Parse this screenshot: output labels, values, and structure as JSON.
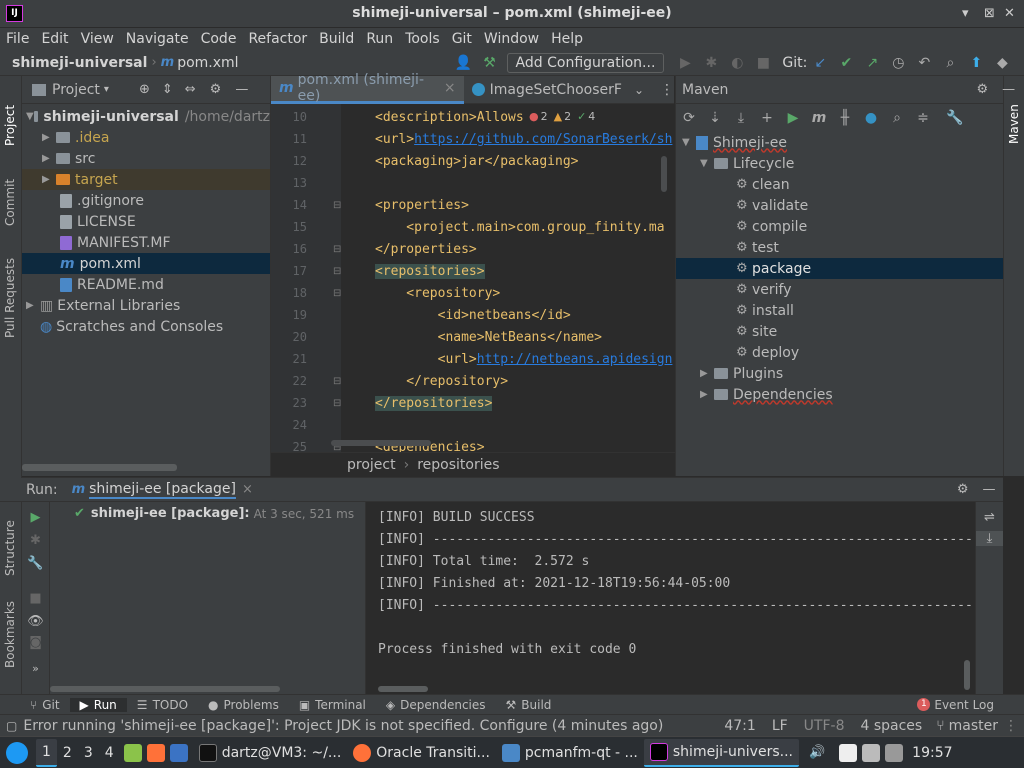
{
  "window": {
    "title": "shimeji-universal – pom.xml (shimeji-ee)",
    "app_icon": "IJ"
  },
  "menu": [
    "File",
    "Edit",
    "View",
    "Navigate",
    "Code",
    "Refactor",
    "Build",
    "Run",
    "Tools",
    "Git",
    "Window",
    "Help"
  ],
  "navbar": {
    "project": "shimeji-universal",
    "file": "pom.xml",
    "add_config": "Add Configuration...",
    "git_label": "Git:"
  },
  "left_stripe": [
    "Project",
    "Commit",
    "Pull Requests",
    "Structure",
    "Bookmarks"
  ],
  "right_stripe": [
    "Maven"
  ],
  "project_panel": {
    "title": "Project",
    "root": {
      "name": "shimeji-universal",
      "path": "/home/dartz"
    },
    "items": [
      {
        "label": ".idea",
        "kind": "folder"
      },
      {
        "label": "src",
        "kind": "folder"
      },
      {
        "label": "target",
        "kind": "folder"
      },
      {
        "label": ".gitignore",
        "kind": "file"
      },
      {
        "label": "LICENSE",
        "kind": "file"
      },
      {
        "label": "MANIFEST.MF",
        "kind": "file"
      },
      {
        "label": "pom.xml",
        "kind": "file"
      },
      {
        "label": "README.md",
        "kind": "file"
      }
    ],
    "external": "External Libraries",
    "scratches": "Scratches and Consoles"
  },
  "editor": {
    "tabs": [
      {
        "label": "pom.xml (shimeji-ee)"
      },
      {
        "label": "ImageSetChooserF"
      }
    ],
    "inspections": {
      "errors": "2",
      "warnings": "2",
      "ok": "4"
    },
    "lines": [
      {
        "n": "10",
        "text": "<description>Allows"
      },
      {
        "n": "11",
        "pre": "<url>",
        "link": "https://github.com/SonarBeserk/sh"
      },
      {
        "n": "12",
        "text": "<packaging>jar</packaging>"
      },
      {
        "n": "13",
        "text": ""
      },
      {
        "n": "14",
        "text": "<properties>"
      },
      {
        "n": "15",
        "text": "    <project.main>com.group_finity.ma"
      },
      {
        "n": "16",
        "text": "</properties>"
      },
      {
        "n": "17",
        "text": "<repositories>"
      },
      {
        "n": "18",
        "text": "    <repository>"
      },
      {
        "n": "19",
        "text": "        <id>netbeans</id>"
      },
      {
        "n": "20",
        "text": "        <name>NetBeans</name>"
      },
      {
        "n": "21",
        "pre": "        <url>",
        "link": "http://netbeans.apidesign"
      },
      {
        "n": "22",
        "text": "    </repository>"
      },
      {
        "n": "23",
        "text": "</repositories>"
      },
      {
        "n": "24",
        "text": ""
      },
      {
        "n": "25",
        "text": "<dependencies>"
      }
    ],
    "breadcrumb": [
      "project",
      "repositories"
    ]
  },
  "maven": {
    "title": "Maven",
    "project": "Shimeji-ee",
    "lifecycle": "Lifecycle",
    "goals": [
      "clean",
      "validate",
      "compile",
      "test",
      "package",
      "verify",
      "install",
      "site",
      "deploy"
    ],
    "plugins": "Plugins",
    "dependencies": "Dependencies"
  },
  "run": {
    "label": "Run:",
    "tab": "shimeji-ee [package]",
    "item": "shimeji-ee [package]:",
    "item_time": "At 3 sec, 521 ms",
    "output": [
      "[INFO] BUILD SUCCESS",
      "[INFO] ------------------------------------------------------------------------",
      "[INFO] Total time:  2.572 s",
      "[INFO] Finished at: 2021-12-18T19:56:44-05:00",
      "[INFO] ------------------------------------------------------------------------",
      "",
      "Process finished with exit code 0"
    ]
  },
  "tool_tabs": [
    "Git",
    "Run",
    "TODO",
    "Problems",
    "Terminal",
    "Dependencies",
    "Build"
  ],
  "event_log": {
    "count": "1",
    "label": "Event Log"
  },
  "status": {
    "message": "Error running 'shimeji-ee [package]': Project JDK is not specified. Configure (4 minutes ago)",
    "position": "47:1",
    "line_sep": "LF",
    "encoding": "UTF-8",
    "indent": "4 spaces",
    "branch": "master"
  },
  "taskbar": {
    "desktops": [
      "1",
      "2",
      "3",
      "4"
    ],
    "tasks": [
      "dartz@VM3: ~/...",
      "Oracle Transiti...",
      "pcmanfm-qt - ...",
      "shimeji-univers..."
    ],
    "clock": "19:57"
  },
  "colors": {
    "accent": "#4a88c7",
    "selection": "#0d293e",
    "success": "#59a869",
    "error": "#db5c5c"
  }
}
